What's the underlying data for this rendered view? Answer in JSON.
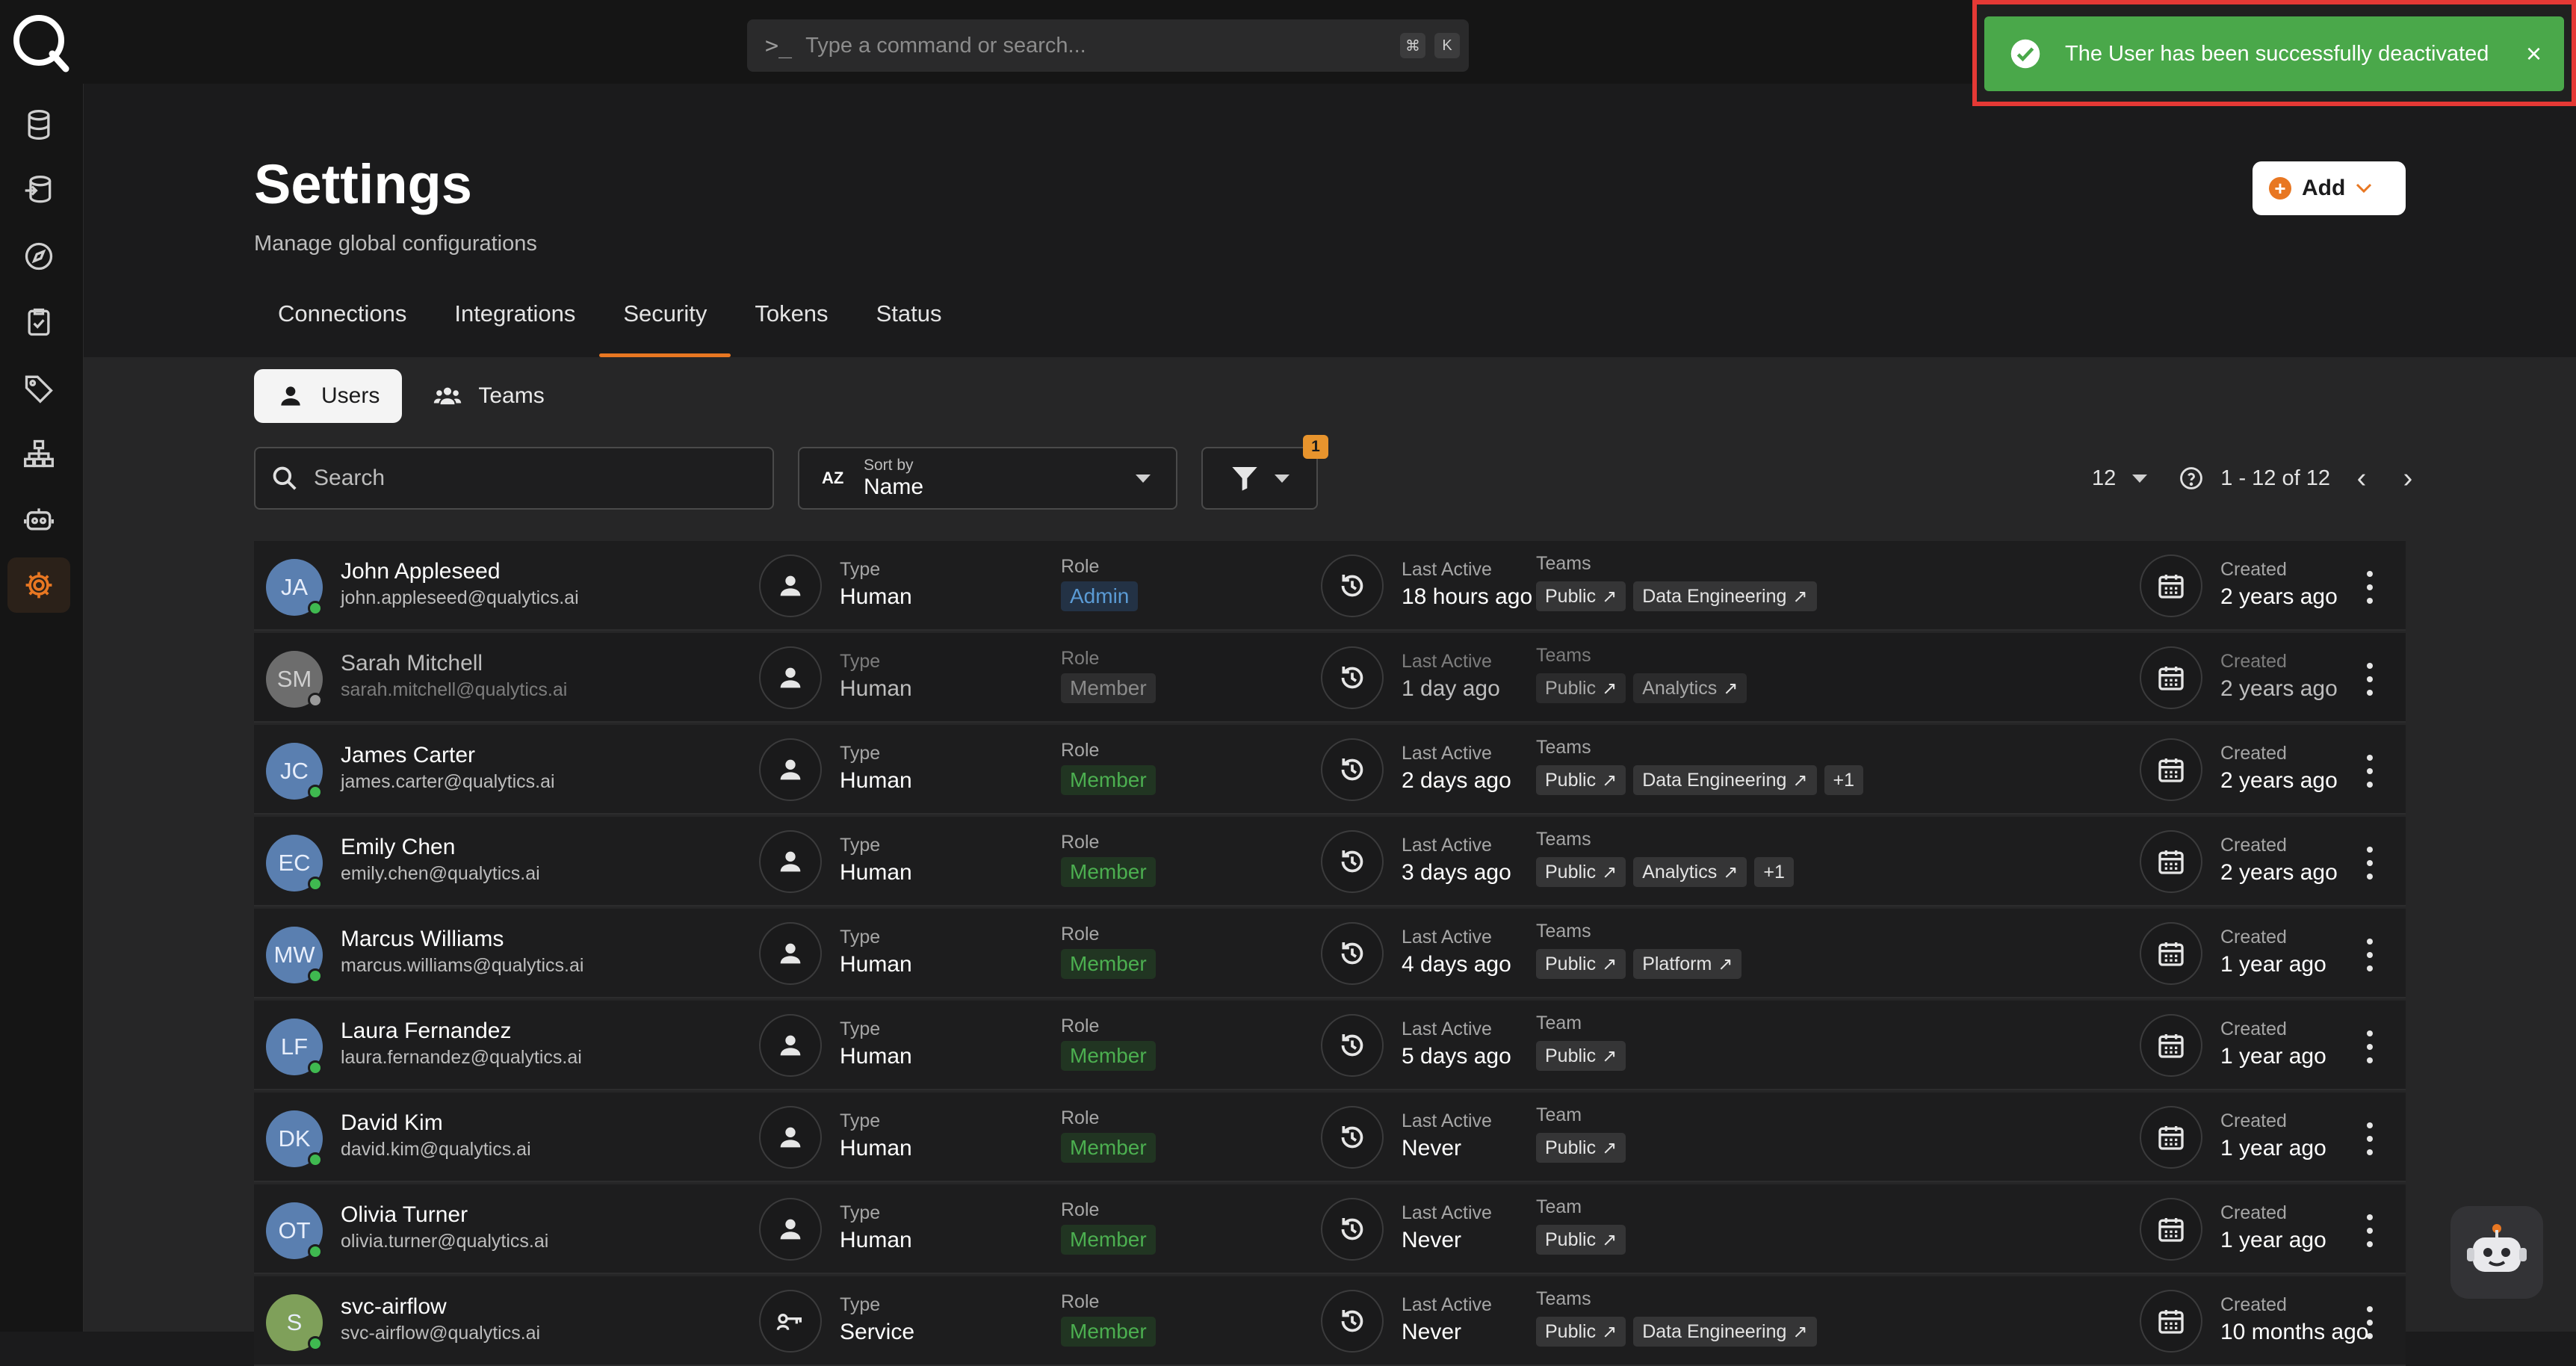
{
  "command_bar": {
    "prompt": ">_",
    "placeholder": "Type a command or search...",
    "shortcut_keys": [
      "⌘",
      "K"
    ]
  },
  "sidebar": {
    "items": [
      "database-icon",
      "datastore-icon",
      "compass-icon",
      "checklist-icon",
      "tag-icon",
      "hierarchy-icon",
      "robot-icon",
      "gear-icon"
    ],
    "active": "gear-icon"
  },
  "page": {
    "title": "Settings",
    "subtitle": "Manage global configurations",
    "add_label": "Add"
  },
  "tabs": [
    "Connections",
    "Integrations",
    "Security",
    "Tokens",
    "Status"
  ],
  "active_tab": "Security",
  "subtabs": {
    "users": "Users",
    "teams": "Teams"
  },
  "search": {
    "placeholder": "Search"
  },
  "sort": {
    "label": "Sort by",
    "value": "Name",
    "icon_text": "AZ"
  },
  "filter": {
    "badge": "1"
  },
  "pagination": {
    "per_page": "12",
    "range": "1 - 12 of 12"
  },
  "labels": {
    "type": "Type",
    "role": "Role",
    "last_active": "Last Active",
    "teams": "Teams",
    "team": "Team",
    "created": "Created"
  },
  "users": [
    {
      "initials": "JA",
      "name": "John Appleseed",
      "email": "john.appleseed@qualytics.ai",
      "type": "Human",
      "role": "Admin",
      "last_active": "18 hours ago",
      "teams_label": "Teams",
      "teams": [
        "Public",
        "Data Engineering"
      ],
      "extra": "",
      "created": "2 years ago",
      "deactivated": false
    },
    {
      "initials": "SM",
      "name": "Sarah Mitchell",
      "email": "sarah.mitchell@qualytics.ai",
      "type": "Human",
      "role": "Member",
      "last_active": "1 day ago",
      "teams_label": "Teams",
      "teams": [
        "Public",
        "Analytics"
      ],
      "extra": "",
      "created": "2 years ago",
      "deactivated": true
    },
    {
      "initials": "JC",
      "name": "James Carter",
      "email": "james.carter@qualytics.ai",
      "type": "Human",
      "role": "Member",
      "last_active": "2 days ago",
      "teams_label": "Teams",
      "teams": [
        "Public",
        "Data Engineering"
      ],
      "extra": "+1",
      "created": "2 years ago",
      "deactivated": false
    },
    {
      "initials": "EC",
      "name": "Emily Chen",
      "email": "emily.chen@qualytics.ai",
      "type": "Human",
      "role": "Member",
      "last_active": "3 days ago",
      "teams_label": "Teams",
      "teams": [
        "Public",
        "Analytics"
      ],
      "extra": "+1",
      "created": "2 years ago",
      "deactivated": false
    },
    {
      "initials": "MW",
      "name": "Marcus Williams",
      "email": "marcus.williams@qualytics.ai",
      "type": "Human",
      "role": "Member",
      "last_active": "4 days ago",
      "teams_label": "Teams",
      "teams": [
        "Public",
        "Platform"
      ],
      "extra": "",
      "created": "1 year ago",
      "deactivated": false
    },
    {
      "initials": "LF",
      "name": "Laura Fernandez",
      "email": "laura.fernandez@qualytics.ai",
      "type": "Human",
      "role": "Member",
      "last_active": "5 days ago",
      "teams_label": "Team",
      "teams": [
        "Public"
      ],
      "extra": "",
      "created": "1 year ago",
      "deactivated": false
    },
    {
      "initials": "DK",
      "name": "David Kim",
      "email": "david.kim@qualytics.ai",
      "type": "Human",
      "role": "Member",
      "last_active": "Never",
      "teams_label": "Team",
      "teams": [
        "Public"
      ],
      "extra": "",
      "created": "1 year ago",
      "deactivated": false
    },
    {
      "initials": "OT",
      "name": "Olivia Turner",
      "email": "olivia.turner@qualytics.ai",
      "type": "Human",
      "role": "Member",
      "last_active": "Never",
      "teams_label": "Team",
      "teams": [
        "Public"
      ],
      "extra": "",
      "created": "1 year ago",
      "deactivated": false
    },
    {
      "initials": "S",
      "name": "svc-airflow",
      "email": "svc-airflow@qualytics.ai",
      "type": "Service",
      "role": "Member",
      "last_active": "Never",
      "teams_label": "Teams",
      "teams": [
        "Public",
        "Data Engineering"
      ],
      "extra": "",
      "created": "10 months ago",
      "deactivated": false
    }
  ],
  "toast": {
    "message": "The User has been successfully deactivated",
    "close": "×"
  },
  "colors": {
    "accent": "#e87722",
    "success": "#4aa84a",
    "admin": "#5b9bd5",
    "member": "#4caf50",
    "highlight": "#e53935"
  }
}
